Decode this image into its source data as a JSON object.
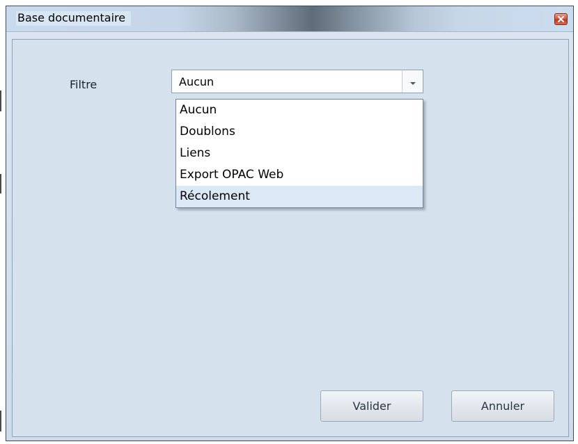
{
  "window": {
    "title": "Base documentaire",
    "close_icon": "close-icon"
  },
  "form": {
    "filter_label": "Filtre",
    "filter_selected": "Aucun",
    "filter_options": [
      "Aucun",
      "Doublons",
      "Liens",
      "Export OPAC Web",
      "Récolement"
    ],
    "hovered_option": "Récolement"
  },
  "buttons": {
    "validate_label": "Valider",
    "cancel_label": "Annuler"
  },
  "colors": {
    "client_background": "#d6e1ee",
    "hover_highlight": "#dbe8f5",
    "close_button": "#c0391f"
  }
}
